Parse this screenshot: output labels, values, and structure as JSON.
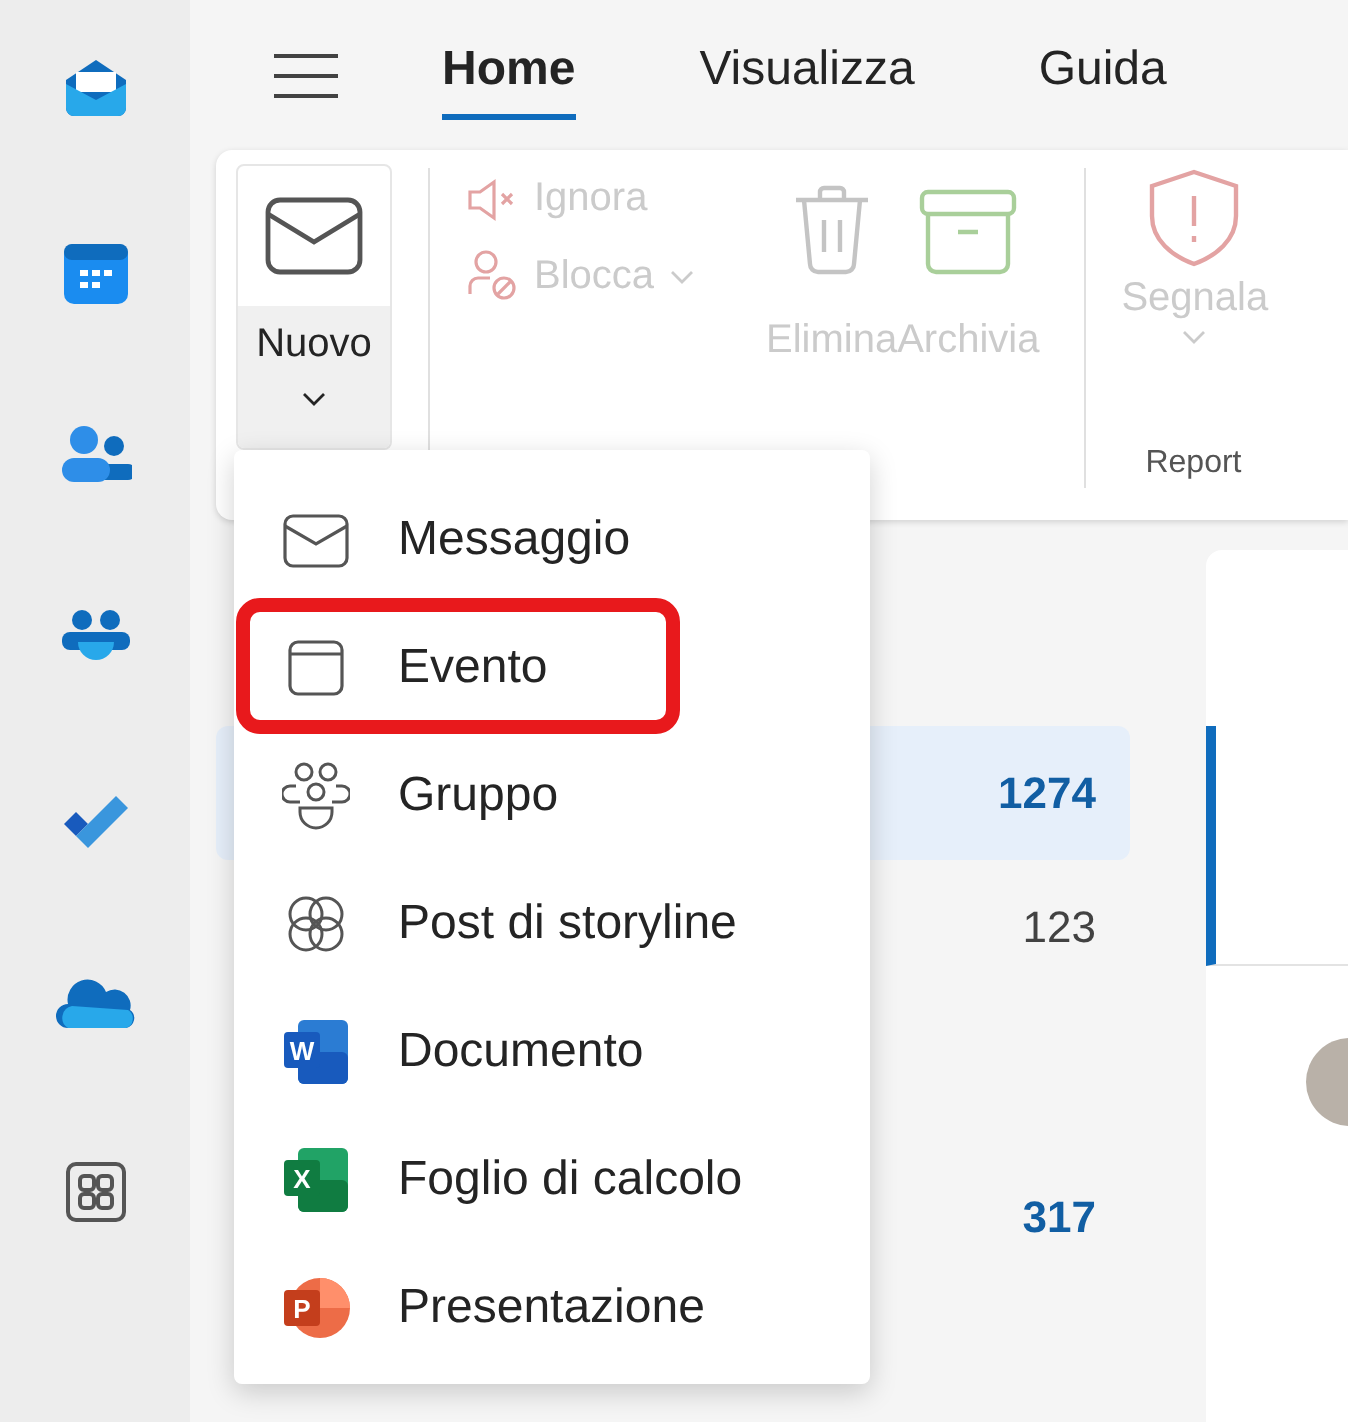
{
  "rail": [
    {
      "kind": "mail"
    },
    {
      "kind": "calendar"
    },
    {
      "kind": "people"
    },
    {
      "kind": "groups"
    },
    {
      "kind": "todo"
    },
    {
      "kind": "cloud"
    },
    {
      "kind": "apps"
    }
  ],
  "tabs": [
    {
      "label": "Home",
      "selected": true
    },
    {
      "label": "Visualizza",
      "selected": false
    },
    {
      "label": "Guida",
      "selected": false
    }
  ],
  "ribbon": {
    "new_button": {
      "label": "Nuovo"
    },
    "small_actions": [
      {
        "kind": "mute",
        "label": "Ignora",
        "disabled": true,
        "has_menu": false
      },
      {
        "kind": "block",
        "label": "Blocca",
        "disabled": true,
        "has_menu": true
      }
    ],
    "large_actions": [
      {
        "kind": "trash",
        "label": "Elimina",
        "disabled": true
      },
      {
        "kind": "archive",
        "label": "Archivia",
        "disabled": true
      }
    ],
    "report_group": {
      "label": "Report",
      "action": {
        "label": "Segnala",
        "disabled": true,
        "has_menu": true
      }
    }
  },
  "folders": [
    {
      "count": "1274",
      "unread": true,
      "selected": true
    },
    {
      "count": "123",
      "unread": false,
      "selected": false
    },
    {
      "count": "317",
      "unread": true,
      "selected": false
    }
  ],
  "messages": [
    {
      "selected": true
    },
    {
      "selected": false
    }
  ],
  "new_menu": [
    {
      "kind": "message",
      "label": "Messaggio",
      "annotated": false
    },
    {
      "kind": "event",
      "label": "Evento",
      "annotated": true
    },
    {
      "kind": "group",
      "label": "Gruppo",
      "annotated": false
    },
    {
      "kind": "storyline",
      "label": "Post di storyline",
      "annotated": false
    },
    {
      "kind": "word",
      "badge": "W",
      "label": "Documento",
      "annotated": false
    },
    {
      "kind": "excel",
      "badge": "X",
      "label": "Foglio di calcolo",
      "annotated": false
    },
    {
      "kind": "powerpoint",
      "badge": "P",
      "label": "Presentazione",
      "annotated": false
    }
  ]
}
